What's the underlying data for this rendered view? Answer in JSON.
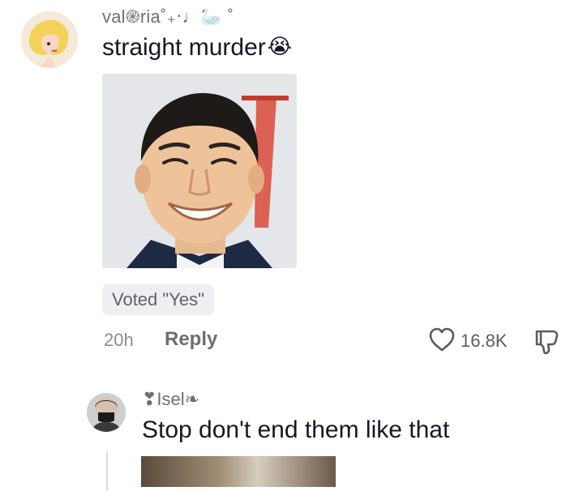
{
  "comment": {
    "username": "val֎ria˚₊‧♩🦢 ˚",
    "text": "straight murder",
    "emoji": "😭",
    "vote_label": "Voted \"Yes\"",
    "timestamp": "20h",
    "reply_label": "Reply",
    "likes": "16.8K"
  },
  "reply": {
    "username": "❣︎Isel❧",
    "text": "Stop don't end them like that"
  },
  "colors": {
    "text_primary": "#161823",
    "text_secondary": "#8a8a91",
    "pill_bg": "#efeff1"
  }
}
